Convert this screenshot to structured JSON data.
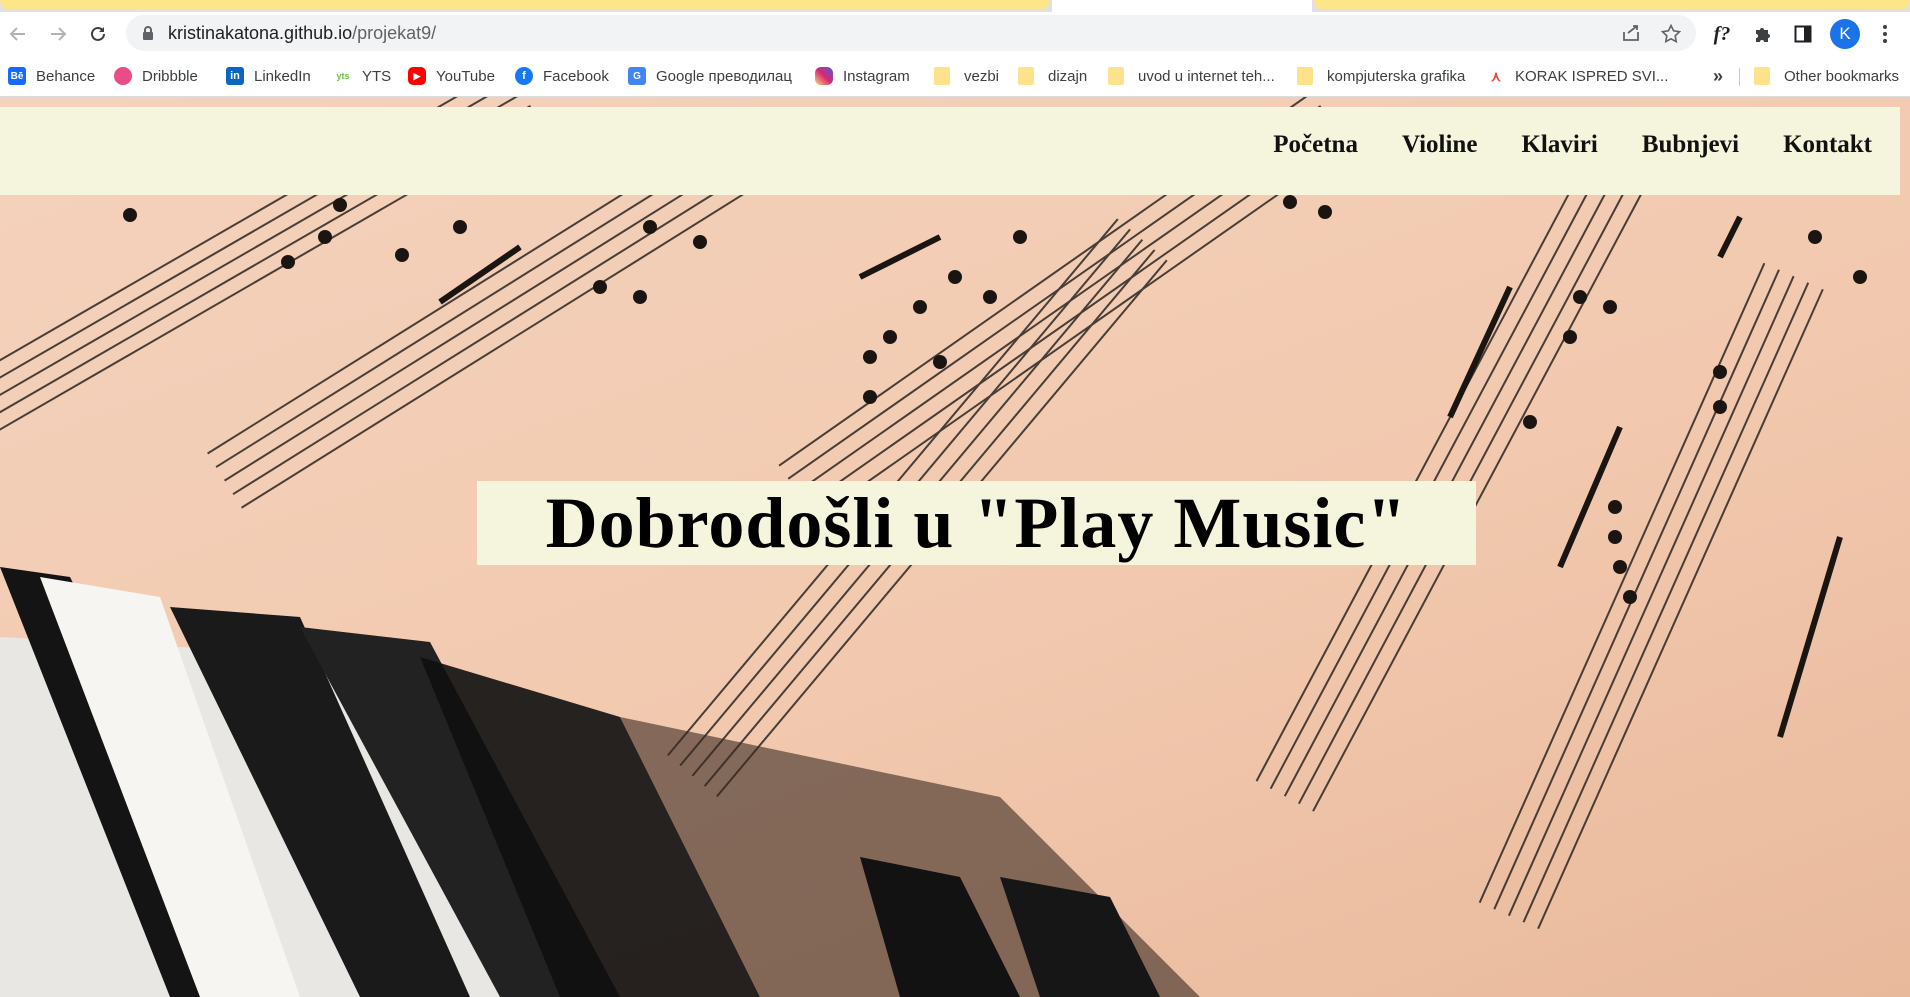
{
  "browser": {
    "url_host": "kristinakatona.github.io",
    "url_path": "/projekat9/",
    "profile_initial": "K",
    "icons": [
      "back-icon",
      "forward-icon",
      "reload-icon",
      "lock-icon",
      "share-icon",
      "star-icon",
      "formula-extension-icon",
      "puzzle-icon",
      "side-panel-icon",
      "kebab-menu-icon"
    ]
  },
  "bookmarks": {
    "items": [
      {
        "label": "Behance",
        "icon": "behance-icon",
        "color": "#1769ff"
      },
      {
        "label": "Dribbble",
        "icon": "dribbble-icon",
        "color": "#ea4c89"
      },
      {
        "label": "LinkedIn",
        "icon": "linkedin-icon",
        "color": "#0a66c2"
      },
      {
        "label": "YTS",
        "icon": "yts-icon",
        "color": "#6ac045"
      },
      {
        "label": "YouTube",
        "icon": "youtube-icon",
        "color": "#ff0000"
      },
      {
        "label": "Facebook",
        "icon": "facebook-icon",
        "color": "#1877f2"
      },
      {
        "label": "Google преводилац",
        "icon": "google-translate-icon",
        "color": "#4285f4"
      },
      {
        "label": "Instagram",
        "icon": "instagram-icon",
        "color": "#e1306c"
      },
      {
        "label": "vezbi",
        "icon": "folder-icon"
      },
      {
        "label": "dizajn",
        "icon": "folder-icon"
      },
      {
        "label": "uvod u internet teh...",
        "icon": "folder-icon"
      },
      {
        "label": "kompjuterska grafika",
        "icon": "folder-icon"
      },
      {
        "label": "KORAK ISPRED SVI...",
        "icon": "korak-icon",
        "color": "#e8453c"
      }
    ],
    "overflow": "»",
    "other": "Other bookmarks"
  },
  "site": {
    "nav": [
      "Početna",
      "Violine",
      "Klaviri",
      "Bubnjevi",
      "Kontakt"
    ],
    "welcome": "Dobrodošli u \"Play Music\""
  }
}
